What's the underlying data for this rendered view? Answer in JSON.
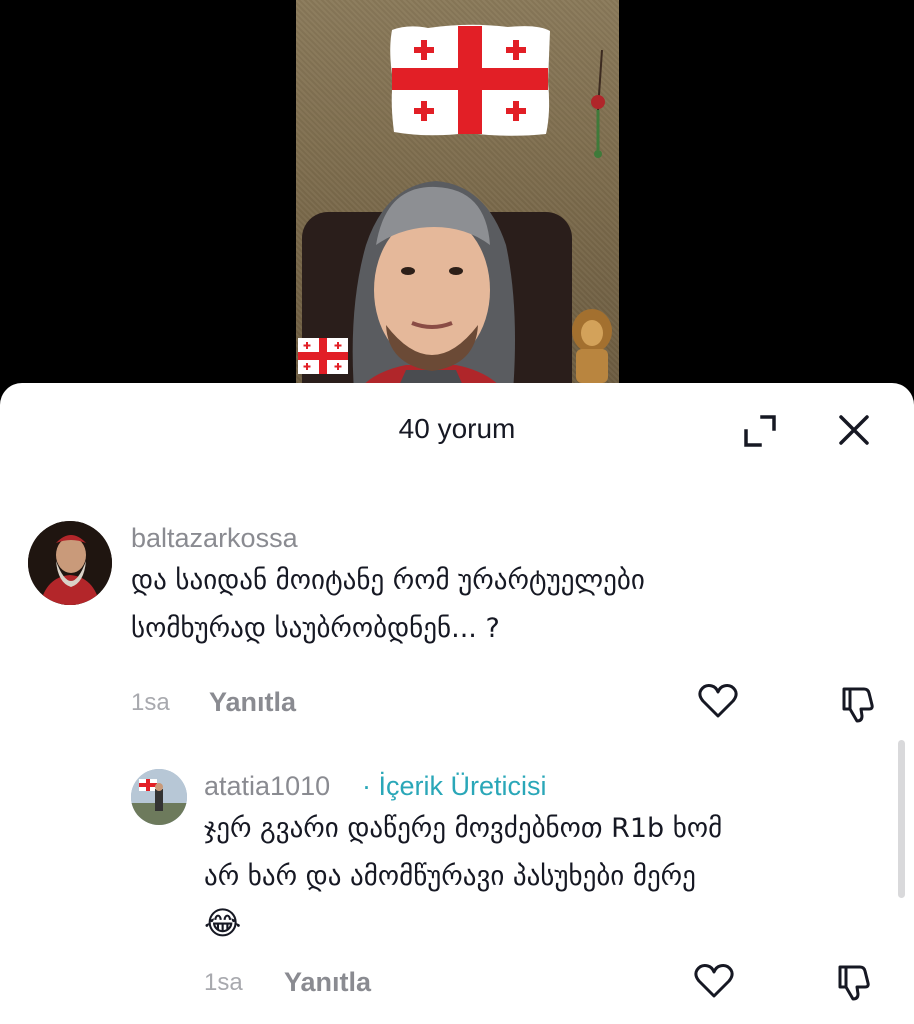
{
  "video": {
    "background_color": "#000000",
    "flag_colors": {
      "white": "#ffffff",
      "red": "#e21f26"
    }
  },
  "comments_panel": {
    "title": "40 yorum",
    "expand_icon": "expand-icon",
    "close_icon": "close-icon"
  },
  "comments": [
    {
      "username": "baltazarkossa",
      "text_line_1": "და საიდან მოიტანე რომ ურარტუელები",
      "text_line_2": "სომხურად საუბრობდნენ... ?",
      "time": "1sa",
      "reply_label": "Yanıtla"
    },
    {
      "username": "atatia1010",
      "creator_tag": "· İçerik Üreticisi",
      "text_line_1": "ჯერ გვარი დაწერე მოვძებნოთ R1b ხომ",
      "text_line_2": "არ ხარ და ამომწურავი პასუხები მერე",
      "emoji": "😂",
      "time": "1sa",
      "reply_label": "Yanıtla"
    }
  ],
  "colors": {
    "accent_creator": "#2aa7b8",
    "text_primary": "#161823",
    "text_secondary": "#8a8b91"
  }
}
